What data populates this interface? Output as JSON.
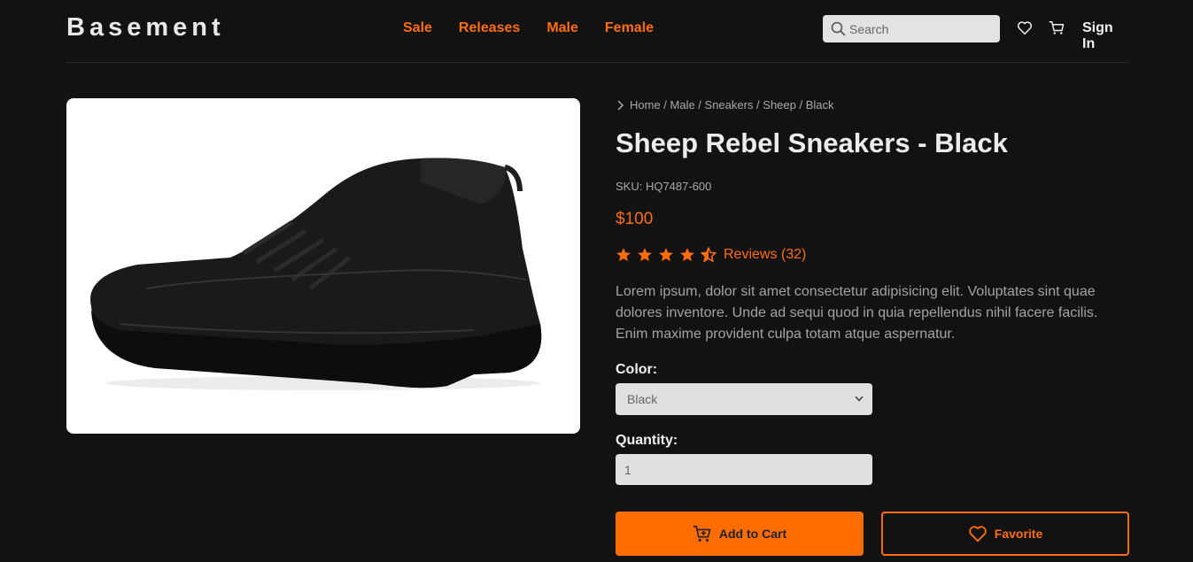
{
  "header": {
    "logo": "Basement",
    "nav": [
      "Sale",
      "Releases",
      "Male",
      "Female"
    ],
    "search_placeholder": "Search",
    "sign_in": "Sign In"
  },
  "breadcrumb": "Home / Male / Sneakers / Sheep / Black",
  "product": {
    "title": "Sheep Rebel Sneakers - Black",
    "sku": "SKU: HQ7487-600",
    "price": "$100",
    "rating": 4.5,
    "reviews": "Reviews (32)",
    "description": "Lorem ipsum, dolor sit amet consectetur adipisicing elit. Voluptates sint quae dolores inventore. Unde ad sequi quod in quia repellendus nihil facere facilis. Enim maxime provident culpa totam atque aspernatur.",
    "image": "black sneaker product photo"
  },
  "options": {
    "color_label": "Color:",
    "color_value": "Black",
    "quantity_label": "Quantity:",
    "quantity_value": "1"
  },
  "actions": {
    "add_to_cart": "Add to Cart",
    "favorite": "Favorite"
  },
  "colors": {
    "accent": "#ff6d0a",
    "background": "#121212"
  },
  "icons": [
    "search-icon",
    "heart-icon",
    "cart-icon",
    "chevron-right-icon",
    "star-icon",
    "star-half-icon",
    "cart-plus-icon",
    "chevron-down-icon"
  ]
}
